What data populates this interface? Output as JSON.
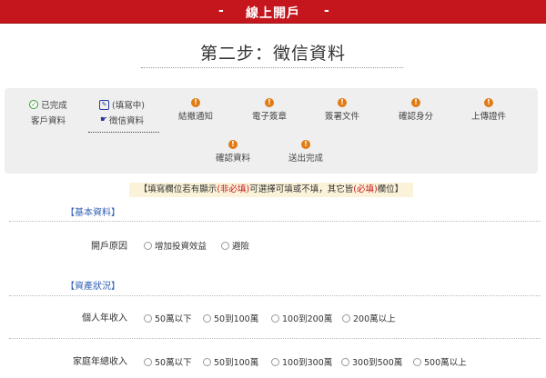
{
  "header": {
    "dash_left": "-",
    "title": "線上開戶",
    "dash_right": "-"
  },
  "step_title": "第二步：徵信資料",
  "progress": {
    "steps": [
      {
        "status_label": "已完成",
        "label": "客戶資料"
      },
      {
        "status_label": "(填寫中)",
        "label": "徵信資料"
      },
      {
        "label": "結撤通知"
      },
      {
        "label": "電子簽章"
      },
      {
        "label": "簽署文件"
      },
      {
        "label": "確認身分"
      },
      {
        "label": "上傳證件"
      },
      {
        "label": "確認資料"
      },
      {
        "label": "送出完成"
      }
    ]
  },
  "notice": {
    "prefix": "【填寫欄位若有顯示",
    "optional": "(非必填)",
    "middle": "可選擇可填或不填，其它皆",
    "required": "(必填)",
    "suffix": "欄位】"
  },
  "sections": {
    "basic": {
      "title": "【基本資料】",
      "rows": [
        {
          "label": "開戶原因",
          "options": [
            "增加投資效益",
            "避險"
          ]
        }
      ]
    },
    "assets": {
      "title": "【資產狀況】",
      "rows": [
        {
          "label": "個人年收入",
          "options": [
            "50萬以下",
            "50到100萬",
            "100到200萬",
            "200萬以上"
          ]
        },
        {
          "label": "家庭年總收入",
          "options": [
            "50萬以下",
            "50到100萬",
            "100到300萬",
            "300到500萬",
            "500萬以上"
          ]
        }
      ]
    }
  },
  "colors": {
    "header": "#c6161d",
    "pending": "#e07b14",
    "done": "#3a9a3a",
    "current": "#2a3b9c",
    "section": "#3060b5"
  }
}
